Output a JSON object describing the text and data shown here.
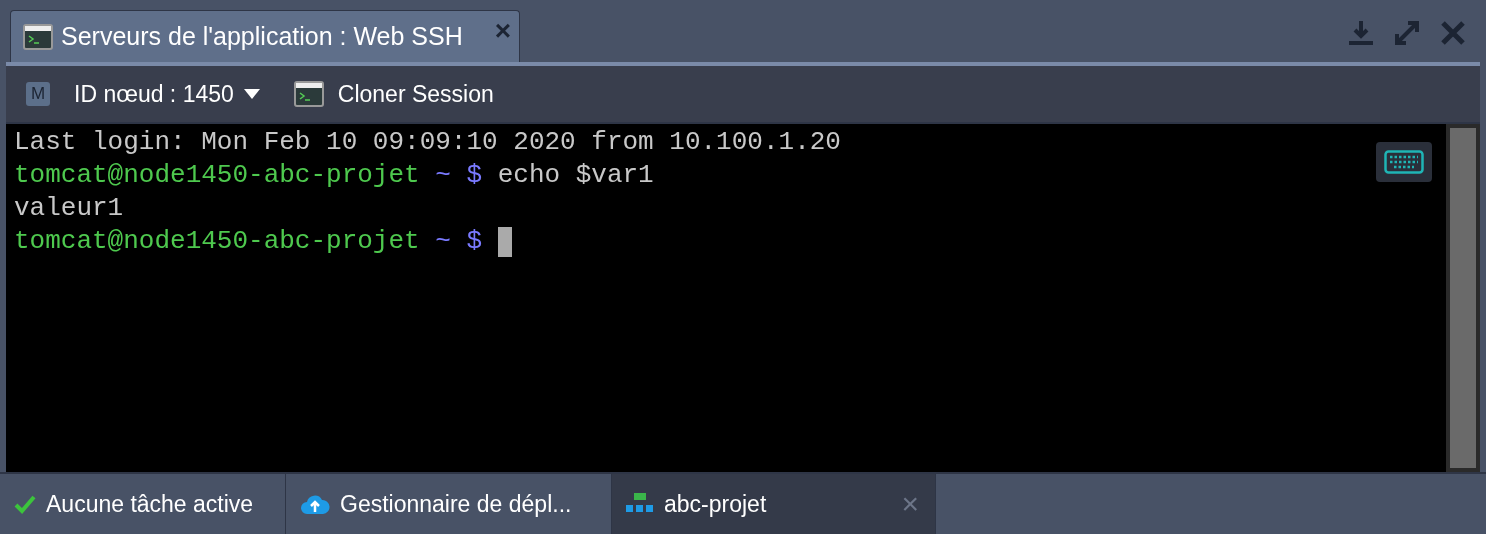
{
  "window": {
    "tab_title": "Serveurs de l'application : Web SSH",
    "tab_close": "×"
  },
  "toolbar": {
    "node_badge": "M",
    "node_label": "ID nœud : 1450",
    "clone_label": "Cloner Session"
  },
  "terminal": {
    "lines": [
      [
        {
          "kind": "plain",
          "text": "Last login: Mon Feb 10 09:09:10 2020 from 10.100.1.20"
        }
      ],
      [
        {
          "kind": "user",
          "text": "tomcat@node1450-abc-projet"
        },
        {
          "kind": "path",
          "text": " ~ $ "
        },
        {
          "kind": "plain",
          "text": "echo $var1"
        }
      ],
      [
        {
          "kind": "plain",
          "text": "valeur1"
        }
      ],
      [
        {
          "kind": "user",
          "text": "tomcat@node1450-abc-projet"
        },
        {
          "kind": "path",
          "text": " ~ $ "
        },
        {
          "kind": "cursor"
        }
      ]
    ]
  },
  "taskbar": [
    {
      "kind": "status",
      "label": "Aucune tâche active",
      "selected": false
    },
    {
      "kind": "upload",
      "label": "Gestionnaire de dépl...",
      "selected": false
    },
    {
      "kind": "env",
      "label": "abc-projet",
      "selected": true,
      "close": "×"
    }
  ]
}
